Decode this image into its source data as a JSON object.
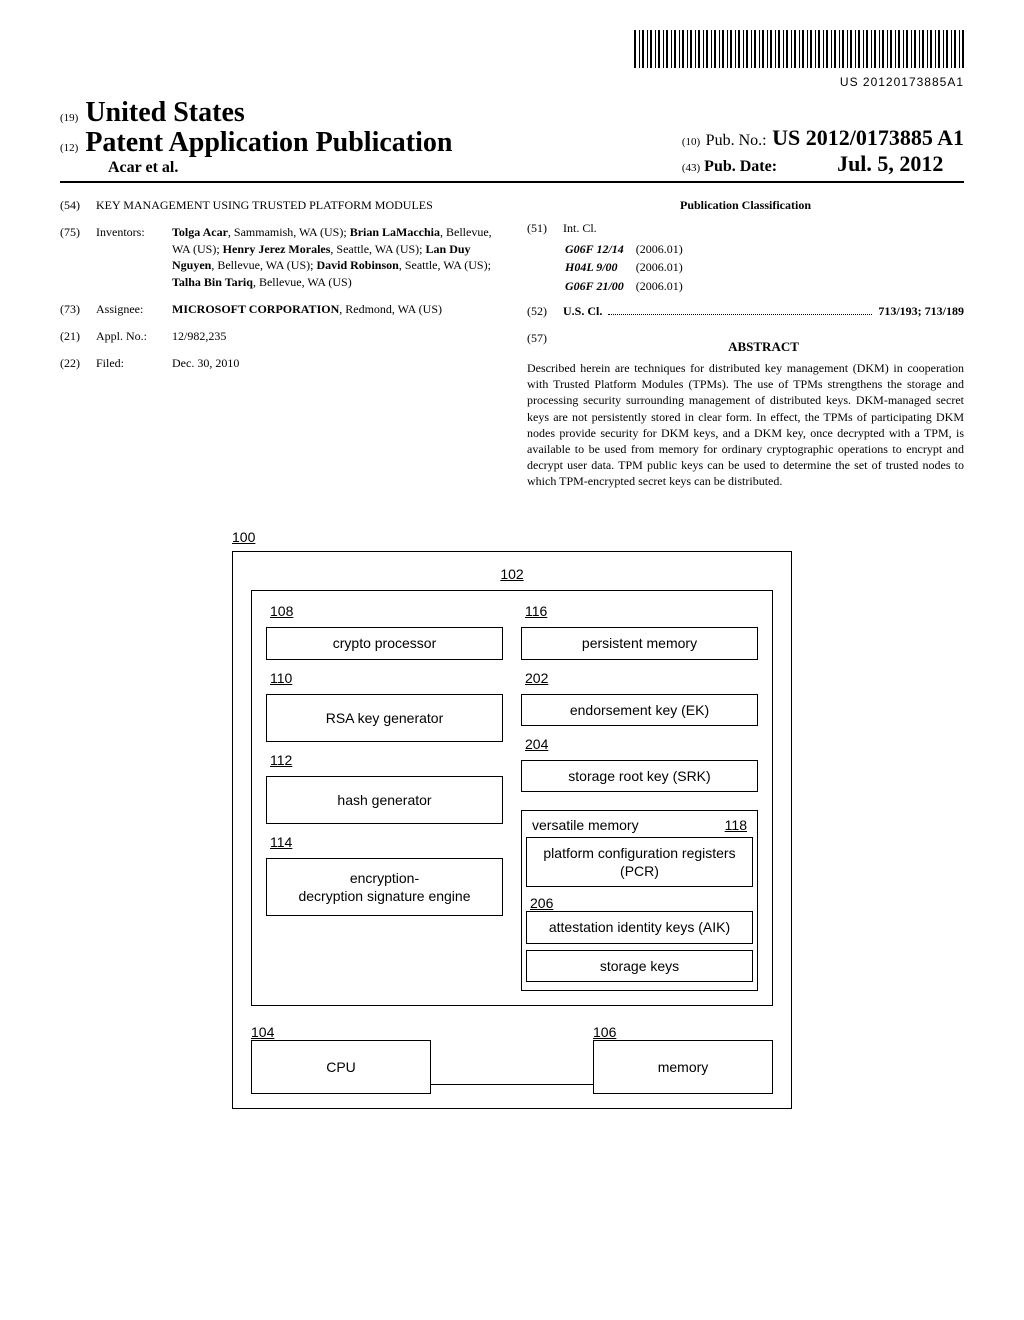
{
  "barcode_number": "US 20120173885A1",
  "header": {
    "country_code": "(19)",
    "country": "United States",
    "doctype_code": "(12)",
    "doctype": "Patent Application Publication",
    "author_line": "Acar et al.",
    "pubno_code": "(10)",
    "pubno_label": "Pub. No.:",
    "pubno": "US 2012/0173885 A1",
    "pubdate_code": "(43)",
    "pubdate_label": "Pub. Date:",
    "pubdate": "Jul. 5, 2012"
  },
  "left_col": {
    "title_code": "(54)",
    "title": "KEY MANAGEMENT USING TRUSTED PLATFORM MODULES",
    "inventors_code": "(75)",
    "inventors_label": "Inventors:",
    "inventors_html": "<span class='bold'>Tolga Acar</span>, Sammamish, WA (US); <span class='bold'>Brian LaMacchia</span>, Bellevue, WA (US); <span class='bold'>Henry Jerez Morales</span>, Seattle, WA (US); <span class='bold'>Lan Duy Nguyen</span>, Bellevue, WA (US); <span class='bold'>David Robinson</span>, Seattle, WA (US); <span class='bold'>Talha Bin Tariq</span>, Bellevue, WA (US)",
    "assignee_code": "(73)",
    "assignee_label": "Assignee:",
    "assignee_html": "<span class='bold'>MICROSOFT CORPORATION</span>, Redmond, WA (US)",
    "applno_code": "(21)",
    "applno_label": "Appl. No.:",
    "applno": "12/982,235",
    "filed_code": "(22)",
    "filed_label": "Filed:",
    "filed": "Dec. 30, 2010"
  },
  "right_col": {
    "classification_heading": "Publication Classification",
    "intcl_code": "(51)",
    "intcl_label": "Int. Cl.",
    "intcl": [
      {
        "cls": "G06F 12/14",
        "ver": "(2006.01)"
      },
      {
        "cls": "H04L 9/00",
        "ver": "(2006.01)"
      },
      {
        "cls": "G06F 21/00",
        "ver": "(2006.01)"
      }
    ],
    "uscl_code": "(52)",
    "uscl_label": "U.S. Cl.",
    "uscl_value": "713/193; 713/189",
    "abstract_code": "(57)",
    "abstract_heading": "ABSTRACT",
    "abstract": "Described herein are techniques for distributed key management (DKM) in cooperation with Trusted Platform Modules (TPMs). The use of TPMs strengthens the storage and processing security surrounding management of distributed keys. DKM-managed secret keys are not persistently stored in clear form. In effect, the TPMs of participating DKM nodes provide security for DKM keys, and a DKM key, once decrypted with a TPM, is available to be used from memory for ordinary cryptographic operations to encrypt and decrypt user data. TPM public keys can be used to determine the set of trusted nodes to which TPM-encrypted secret keys can be distributed."
  },
  "figure": {
    "ref_100": "100",
    "ref_102": "102",
    "ref_108": "108",
    "crypto_processor": "crypto processor",
    "ref_110": "110",
    "rsa_key_generator": "RSA key generator",
    "ref_112": "112",
    "hash_generator": "hash generator",
    "ref_114": "114",
    "enc_engine": "encryption-\ndecryption signature engine",
    "ref_116": "116",
    "persistent_memory": "persistent memory",
    "ref_202": "202",
    "endorsement_key": "endorsement key (EK)",
    "ref_204": "204",
    "storage_root_key": "storage root key (SRK)",
    "versatile_memory": "versatile memory",
    "ref_118": "118",
    "pcr": "platform configuration registers (PCR)",
    "ref_206": "206",
    "aik": "attestation identity keys (AIK)",
    "storage_keys": "storage keys",
    "ref_104": "104",
    "cpu": "CPU",
    "ref_106": "106",
    "memory": "memory"
  }
}
